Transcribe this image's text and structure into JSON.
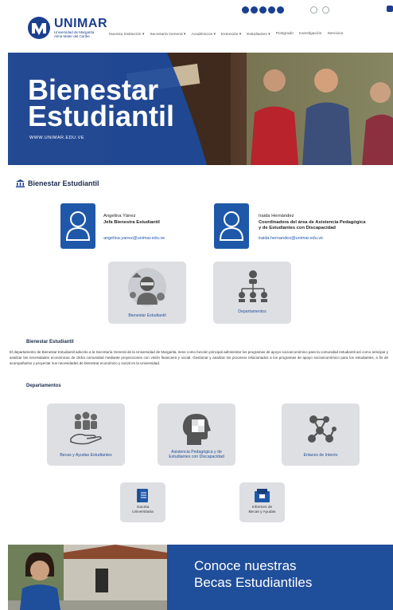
{
  "header": {
    "logo_name": "UNIMAR",
    "logo_sub1": "Universidad de Margarita",
    "logo_sub2": "Alma Mater del Caribe",
    "nav": [
      "Nuestra Institución ▾",
      "Secretaría General ▾",
      "Académicos ▾",
      "Extensión ▾",
      "Estudiantes ▾",
      "Postgrado",
      "Investigación",
      "Servicios"
    ]
  },
  "hero": {
    "title_line1": "Bienestar",
    "title_line2": "Estudiantil",
    "url": "WWW.UNIMAR.EDU.VE"
  },
  "section": {
    "title": "Bienestar Estudiantil"
  },
  "staff": [
    {
      "name": "Angelina Yánez",
      "role_line1": "Jefa Bienestra Estudiantil",
      "role_line2": "",
      "email": "angelina.yanez@unimar.edu.ve"
    },
    {
      "name": "Iraida Hernández",
      "role_line1": "Coordinadora del área de Asistencia Pedagógica",
      "role_line2": "y de Estudiantes con Discapacidad",
      "email": "iraida.hernandez@unimar.edu.ve"
    }
  ],
  "top_tiles": [
    {
      "label": "Bienestar Estudiantil",
      "icon": "student-icon"
    },
    {
      "label": "Departamentos",
      "icon": "org-chart-icon"
    }
  ],
  "about": {
    "title": "Bienestar Estudiantil",
    "text": "El departamento de Bienestar Estudiantil adscrito a la Secretaría General de la Universidad de Margarita, tiene como función principal administrar los programas de apoyo socioeconómico para la comunidad estudiantil así como anticipar y analizar las necesidades económicas de dicha comunidad mediante proyecciones con visión financiera y social. Gestionar y analizar los procesos relacionados a los programas de apoyo socioeconómico para los estudiantes, a fin de acompañarlos y proyectar sus necesidades de bienestar económico y social en la Universidad."
  },
  "departments": {
    "title": "Departamentos",
    "items": [
      {
        "label_line1": "Becas y Ayudas Estudiantes",
        "label_line2": "",
        "icon": "scholarship-icon"
      },
      {
        "label_line1": "Asistencia Pedagógica y de",
        "label_line2": "Estudiantes con Discapacidad",
        "icon": "head-puzzle-icon"
      },
      {
        "label_line1": "Enlaces de Interés",
        "label_line2": "",
        "icon": "network-icon"
      }
    ],
    "small": [
      {
        "label_line1": "Gaceta",
        "label_line2": "Universitaria",
        "icon": "book-icon"
      },
      {
        "label_line1": "Informes de",
        "label_line2": "Becas y Ayudas",
        "icon": "report-icon"
      }
    ]
  },
  "banner": {
    "line1": "Conoce nuestras",
    "line2": "Becas Estudiantiles"
  },
  "colors": {
    "brand": "#1b3f8f",
    "accent": "#1f58a8",
    "tile": "#dedfe2"
  }
}
